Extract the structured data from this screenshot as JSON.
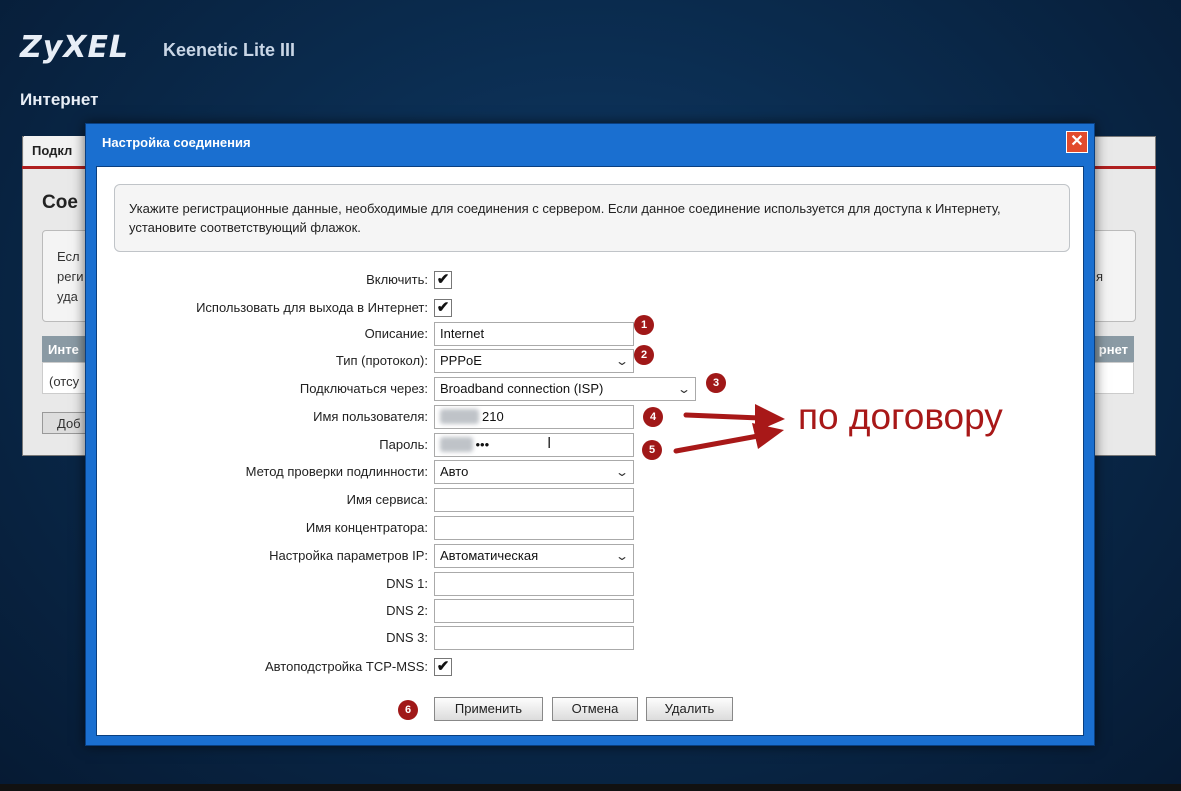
{
  "brand": {
    "logo": "ZyXEL",
    "model": "Keenetic Lite III"
  },
  "page": {
    "section_title": "Интернет"
  },
  "background": {
    "tab_label": "Подкл",
    "heading": "Сое",
    "box_lines": [
      "Есл",
      "реги",
      "уда"
    ],
    "box_right": "я",
    "thead_left": "Инте",
    "thead_right": "рнет",
    "row_text": "(отсу",
    "button": "Доб"
  },
  "dialog": {
    "title": "Настройка соединения",
    "close_symbol": "✕",
    "info_text": "Укажите регистрационные данные, необходимые для соединения с сервером. Если данное соединение используется для доступа к Интернету, установите соответствующий флажок.",
    "labels": {
      "enable": "Включить:",
      "use_for_internet": "Использовать для выхода в Интернет:",
      "description": "Описание:",
      "type": "Тип (протокол):",
      "connect_via": "Подключаться через:",
      "username": "Имя пользователя:",
      "password": "Пароль:",
      "auth_method": "Метод проверки подлинности:",
      "service_name": "Имя сервиса:",
      "concentrator_name": "Имя концентратора:",
      "ip_settings": "Настройка параметров IP:",
      "dns1": "DNS 1:",
      "dns2": "DNS 2:",
      "dns3": "DNS 3:",
      "tcp_mss": "Автоподстройка TCP-MSS:"
    },
    "values": {
      "enable_check": "✔",
      "use_for_internet_check": "✔",
      "description": "Internet",
      "type": "PPPoE",
      "connect_via": "Broadband connection (ISP)",
      "username_suffix": "210",
      "password_visible": "•••",
      "auth_method": "Авто",
      "service_name": "",
      "concentrator_name": "",
      "ip_settings": "Автоматическая",
      "dns1": "",
      "dns2": "",
      "dns3": "",
      "tcp_mss_check": "✔"
    },
    "buttons": {
      "apply": "Применить",
      "cancel": "Отмена",
      "delete": "Удалить"
    }
  },
  "annotations": {
    "badges": [
      "1",
      "2",
      "3",
      "4",
      "5",
      "6"
    ],
    "note": "по договору",
    "colors": {
      "badge": "#a01818",
      "note": "#a81818",
      "dialog_frame": "#1a6fd0"
    }
  }
}
